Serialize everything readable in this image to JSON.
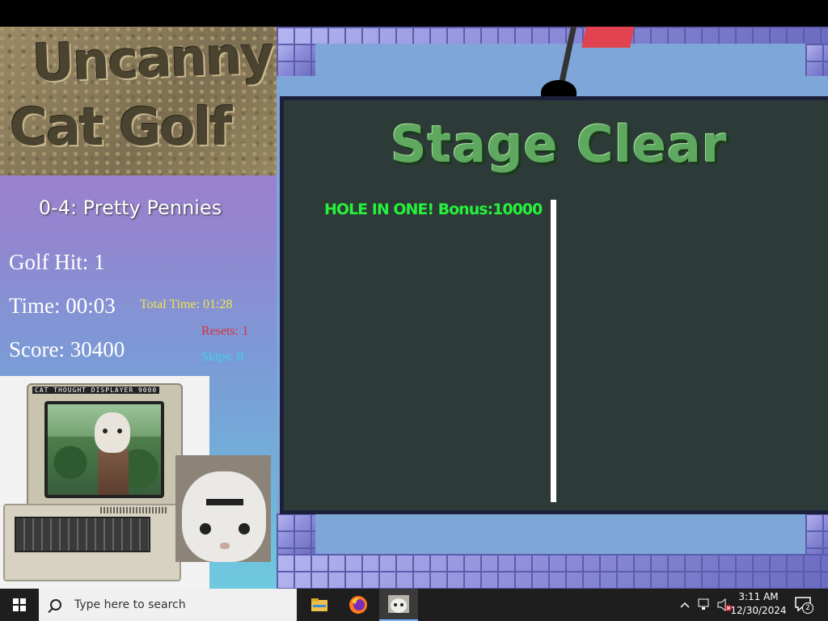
{
  "game": {
    "logo_line1": "Uncanny",
    "logo_line2": "Cat Golf",
    "level_name": "0-4: Pretty Pennies",
    "golf_hit": "Golf Hit: 1",
    "time": "Time: 00:03",
    "total_time": "Total Time: 01:28",
    "resets": "Resets: 1",
    "skips": "Skips: 0",
    "score": "Score: 30400",
    "monitor_label": "CAT THOUGHT DISPLAYER 9000",
    "stage_title": "Stage Clear",
    "bonus_text": "HOLE IN ONE! Bonus:10000",
    "colors": {
      "total_time": "#f2e64a",
      "resets": "#d8323c",
      "skips": "#38d6e8",
      "bonus": "#27f03b",
      "panel": "#2c3a38",
      "bricks": "#8a8ad8"
    }
  },
  "taskbar": {
    "search_placeholder": "Type here to search",
    "apps": [
      "file-explorer-icon",
      "firefox-icon",
      "cat-golf-icon"
    ],
    "time": "3:11 AM",
    "date": "12/30/2024",
    "notification_count": "2"
  }
}
